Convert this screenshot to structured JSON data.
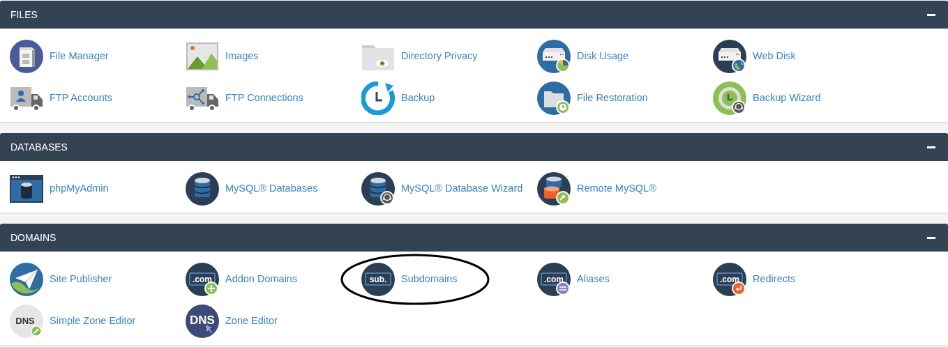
{
  "sections": [
    {
      "title": "FILES",
      "expanded": true,
      "items": [
        {
          "label": "File Manager",
          "kind": "file-manager"
        },
        {
          "label": "Images",
          "kind": "images"
        },
        {
          "label": "Directory Privacy",
          "kind": "folder-eye"
        },
        {
          "label": "Disk Usage",
          "kind": "disk-usage"
        },
        {
          "label": "Web Disk",
          "kind": "web-disk"
        },
        {
          "label": "FTP Accounts",
          "kind": "ftp-accounts"
        },
        {
          "label": "FTP Connections",
          "kind": "ftp-connections"
        },
        {
          "label": "Backup",
          "kind": "backup"
        },
        {
          "label": "File Restoration",
          "kind": "file-restoration"
        },
        {
          "label": "Backup Wizard",
          "kind": "backup-wizard"
        }
      ]
    },
    {
      "title": "DATABASES",
      "expanded": true,
      "items": [
        {
          "label": "phpMyAdmin",
          "kind": "phpmyadmin"
        },
        {
          "label": "MySQL® Databases",
          "kind": "mysql"
        },
        {
          "label": "MySQL® Database Wizard",
          "kind": "mysql-wizard"
        },
        {
          "label": "Remote MySQL®",
          "kind": "remote-mysql"
        }
      ]
    },
    {
      "title": "DOMAINS",
      "expanded": true,
      "items": [
        {
          "label": "Site Publisher",
          "kind": "site-publisher"
        },
        {
          "label": "Addon Domains",
          "kind": "domain-plus",
          "icon_text": ".com"
        },
        {
          "label": "Subdomains",
          "kind": "subdomain",
          "icon_text": "sub.",
          "circled": true
        },
        {
          "label": "Aliases",
          "kind": "domain-minus",
          "icon_text": ".com"
        },
        {
          "label": "Redirects",
          "kind": "domain-redirect",
          "icon_text": ".com"
        },
        {
          "label": "Simple Zone Editor",
          "kind": "dns-light",
          "icon_text": "DNS"
        },
        {
          "label": "Zone Editor",
          "kind": "dns-dark",
          "icon_text": "DNS"
        }
      ]
    }
  ]
}
